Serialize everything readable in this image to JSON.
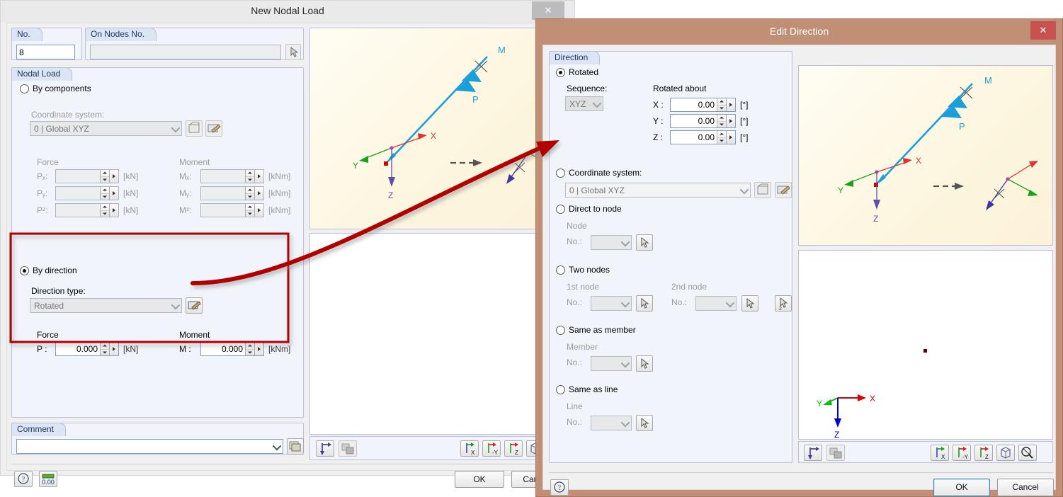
{
  "main_dialog": {
    "title": "New Nodal Load",
    "close_label": "✕",
    "no_group": {
      "header": "No.",
      "value": "8"
    },
    "on_nodes_group": {
      "header": "On Nodes No.",
      "value": "",
      "pick_icon": "pick-node-icon"
    },
    "nodal_load_group": {
      "header": "Nodal Load",
      "by_components": {
        "label": "By components",
        "selected": false,
        "coordinate_system_label": "Coordinate system:",
        "coordinate_system_value": "0 | Global XYZ",
        "new_icon": "new-coordinate-system-icon",
        "edit_icon": "edit-coordinate-system-icon",
        "force_label": "Force",
        "moment_label": "Moment",
        "force_rows": [
          {
            "label": "Pₓ:",
            "value": "",
            "unit": "[kN]"
          },
          {
            "label": "Pᵧ:",
            "value": "",
            "unit": "[kN]"
          },
          {
            "label": "Pᶻ:",
            "value": "",
            "unit": "[kN]"
          }
        ],
        "moment_rows": [
          {
            "label": "Mₓ:",
            "value": "",
            "unit": "[kNm]"
          },
          {
            "label": "Mᵧ:",
            "value": "",
            "unit": "[kNm]"
          },
          {
            "label": "Mᶻ:",
            "value": "",
            "unit": "[kNm]"
          }
        ]
      },
      "by_direction": {
        "label": "By direction",
        "selected": true,
        "direction_type_label": "Direction type:",
        "direction_type_value": "Rotated",
        "edit_icon": "edit-direction-icon",
        "force_label": "Force",
        "moment_label": "Moment",
        "force_row": {
          "label": "P :",
          "value": "0.000",
          "unit": "[kN]"
        },
        "moment_row": {
          "label": "M :",
          "value": "0.000",
          "unit": "[kNm]"
        }
      }
    },
    "comment_group": {
      "header": "Comment",
      "value": "",
      "library_icon": "comment-library-icon"
    },
    "footer": {
      "help_icon": "help-icon",
      "units_icon": "units-decimals-icon",
      "ok_label": "OK",
      "cancel_label": "Cancel"
    },
    "viewport_top": {
      "labels": {
        "M": "M",
        "P": "P",
        "X": "X",
        "Y": "Y",
        "Z": "Z"
      }
    },
    "viewport_toolbar": {
      "buttons": [
        {
          "name": "show-origin-icon",
          "label": ""
        },
        {
          "name": "render-mode-icon",
          "label": ""
        },
        {
          "name": "view-in-x-icon",
          "label": "X"
        },
        {
          "name": "view-in-minus-y-icon",
          "label": "-Y"
        },
        {
          "name": "view-in-z-icon",
          "label": "Z"
        },
        {
          "name": "isometric-view-icon",
          "label": ""
        }
      ]
    }
  },
  "direction_dialog": {
    "title": "Edit Direction",
    "close_label": "✕",
    "group_header": "Direction",
    "options": {
      "rotated": {
        "label": "Rotated",
        "selected": true,
        "sequence_label": "Sequence:",
        "sequence_value": "XYZ",
        "rotated_about_label": "Rotated about",
        "angles": [
          {
            "label": "X :",
            "value": "0.00",
            "unit": "[°]"
          },
          {
            "label": "Y :",
            "value": "0.00",
            "unit": "[°]"
          },
          {
            "label": "Z :",
            "value": "0.00",
            "unit": "[°]"
          }
        ]
      },
      "coordinate_system": {
        "label": "Coordinate system:",
        "selected": false,
        "value": "0 | Global XYZ",
        "new_icon": "new-coordinate-system-icon",
        "edit_icon": "edit-coordinate-system-icon"
      },
      "direct_to_node": {
        "label": "Direct to node",
        "selected": false,
        "sub_label": "Node",
        "no_label": "No.:",
        "value": "",
        "pick_icon": "pick-node-icon"
      },
      "two_nodes": {
        "label": "Two nodes",
        "selected": false,
        "first_label": "1st node",
        "second_label": "2nd node",
        "no_label": "No.:",
        "first_value": "",
        "second_value": "",
        "pick_icon": "pick-node-icon",
        "pick_two_icon": "pick-two-nodes-icon"
      },
      "same_as_member": {
        "label": "Same as member",
        "selected": false,
        "sub_label": "Member",
        "no_label": "No.:",
        "value": "",
        "pick_icon": "pick-member-icon"
      },
      "same_as_line": {
        "label": "Same as line",
        "selected": false,
        "sub_label": "Line",
        "no_label": "No.:",
        "value": "",
        "pick_icon": "pick-line-icon"
      }
    },
    "viewport_top": {
      "labels": {
        "M": "M",
        "P": "P",
        "X": "X",
        "Y": "Y",
        "Z": "Z"
      }
    },
    "viewport_bottom": {
      "labels": {
        "X": "X",
        "Y": "Y",
        "Z": "Z"
      }
    },
    "viewport_toolbar": {
      "buttons": [
        {
          "name": "show-origin-icon",
          "label": ""
        },
        {
          "name": "render-mode-icon",
          "label": ""
        },
        {
          "name": "view-in-x-icon",
          "label": "X"
        },
        {
          "name": "view-in-minus-y-icon",
          "label": "-Y"
        },
        {
          "name": "view-in-z-icon",
          "label": "Z"
        },
        {
          "name": "isometric-view-icon",
          "label": ""
        },
        {
          "name": "zoom-all-icon",
          "label": ""
        }
      ]
    },
    "footer": {
      "help_icon": "help-icon",
      "ok_label": "OK",
      "cancel_label": "Cancel"
    }
  },
  "annotation": {
    "highlight_color": "#b00000",
    "arrow_color": "#b00000",
    "description": "red rounded highlight around By direction section with curved arrow to Edit Direction dialog"
  },
  "colors": {
    "dialog_frame_brown": "#c08f75",
    "close_red": "#c8524f",
    "group_header_blue": "#dbe5f4",
    "group_body_blue": "#f1f5fb",
    "axis_x_red": "#e03030",
    "axis_y_green": "#17a317",
    "axis_z_purple": "#5b4fa8",
    "load_arrow_blue": "#1b9fd8"
  }
}
